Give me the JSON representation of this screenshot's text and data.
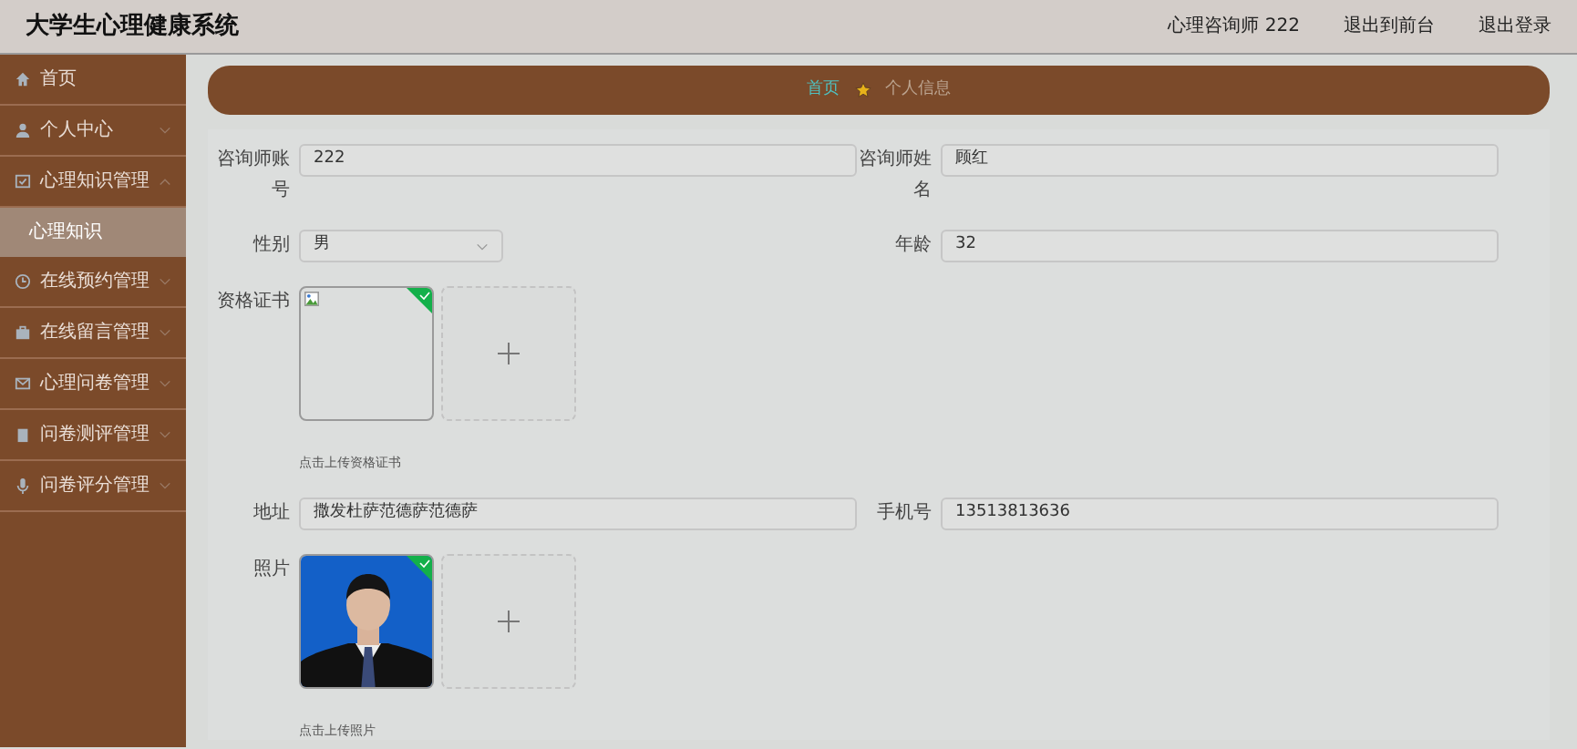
{
  "header": {
    "title": "大学生心理健康系统",
    "user": "心理咨询师 222",
    "links": [
      "退出到前台",
      "退出登录"
    ]
  },
  "sidebar": {
    "items": [
      {
        "label": "首页"
      },
      {
        "label": "个人中心",
        "expanded": false
      },
      {
        "label": "心理知识管理",
        "expanded": true,
        "children": [
          {
            "label": "心理知识",
            "selected": true
          }
        ]
      },
      {
        "label": "在线预约管理",
        "expanded": false
      },
      {
        "label": "在线留言管理",
        "expanded": false
      },
      {
        "label": "心理问卷管理",
        "expanded": false
      },
      {
        "label": "问卷测评管理",
        "expanded": false
      },
      {
        "label": "问卷评分管理",
        "expanded": false
      }
    ]
  },
  "breadcrumb": [
    {
      "label": "首页",
      "kind": "link"
    },
    {
      "label": "个人信息",
      "kind": "current"
    }
  ],
  "form": {
    "rows": [
      [
        {
          "label": "咨询师账号",
          "kind": "text",
          "value": "222"
        },
        {
          "label": "咨询师姓名",
          "kind": "text",
          "value": "顾红"
        }
      ],
      [
        {
          "label": "性别",
          "kind": "select",
          "value": "男"
        },
        {
          "label": "年龄",
          "kind": "text",
          "value": "32"
        }
      ],
      [
        {
          "label": "资格证书",
          "kind": "upload",
          "preview": {
            "kind": "broken_image"
          },
          "uploaded": true,
          "hint": "点击上传资格证书"
        }
      ],
      [
        {
          "label": "地址",
          "kind": "text",
          "value": "撒发杜萨范德萨范德萨"
        },
        {
          "label": "手机号",
          "kind": "text",
          "value": "13513813636"
        }
      ],
      [
        {
          "label": "照片",
          "kind": "upload",
          "uploaded": true,
          "hint": "点击上传照片"
        }
      ]
    ]
  }
}
